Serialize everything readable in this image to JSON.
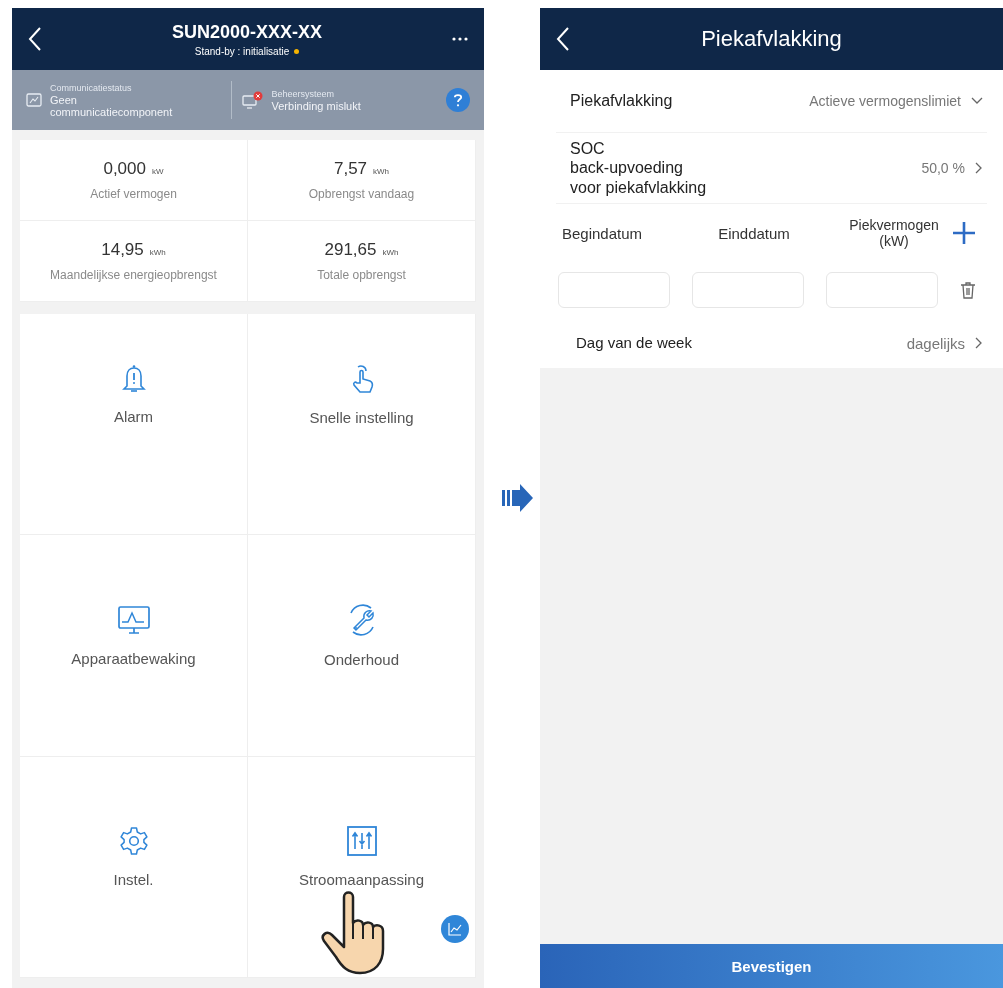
{
  "device_screen": {
    "title": "SUN2000-XXX-XX",
    "subtitle": "Stand-by : initialisatie",
    "status_panel": [
      {
        "kind": "communication",
        "caption": "Communicatiestatus",
        "value": "Geen communicatiecomponent"
      },
      {
        "kind": "management",
        "caption": "Beheersysteem",
        "value": "Verbinding mislukt"
      }
    ],
    "stats": [
      {
        "value": "0,000",
        "unit": "kW",
        "label": "Actief vermogen"
      },
      {
        "value": "7,57",
        "unit": "kWh",
        "label": "Opbrengst vandaag"
      },
      {
        "value": "14,95",
        "unit": "kWh",
        "label": "Maandelijkse energieopbrengst"
      },
      {
        "value": "291,65",
        "unit": "kWh",
        "label": "Totale opbrengst"
      }
    ],
    "tiles": [
      {
        "kind": "bell",
        "label": "Alarm"
      },
      {
        "kind": "tap",
        "label": "Snelle instelling"
      },
      {
        "kind": "monitor",
        "label": "Apparaatbewaking"
      },
      {
        "kind": "wrench",
        "label": "Onderhoud"
      },
      {
        "kind": "gear",
        "label": "Instel."
      },
      {
        "kind": "sliders",
        "label": "Stroomaanpassing"
      }
    ]
  },
  "settings_screen": {
    "title": "Piekafvlakking",
    "mode": {
      "label": "Piekafvlakking",
      "value": "Actieve vermogenslimiet"
    },
    "soc": {
      "label_lines": [
        "SOC",
        "back-upvoeding",
        "voor piekafvlakking"
      ],
      "value": "50,0 %"
    },
    "columns": [
      "Begindatum",
      "Einddatum",
      "Piekvermogen(kW)"
    ],
    "weekday": {
      "label": "Dag van de week",
      "value": "dagelijks"
    },
    "confirm_button": "Bevestigen"
  }
}
